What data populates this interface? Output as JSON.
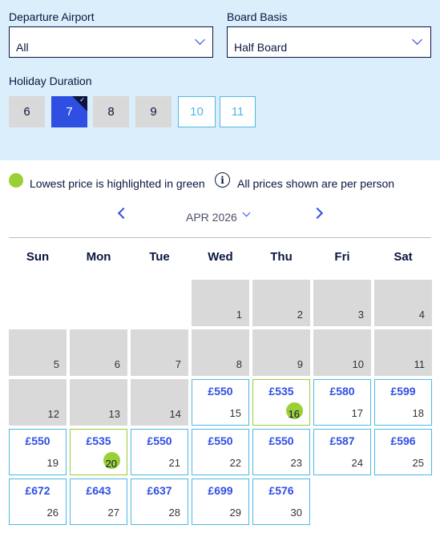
{
  "filters": {
    "departure_airport": {
      "label": "Departure Airport",
      "value": "All"
    },
    "board_basis": {
      "label": "Board Basis",
      "value": "Half Board"
    },
    "holiday_duration": {
      "label": "Holiday Duration",
      "options": [
        {
          "label": "6",
          "state": "disabled"
        },
        {
          "label": "7",
          "state": "selected"
        },
        {
          "label": "8",
          "state": "disabled"
        },
        {
          "label": "9",
          "state": "disabled"
        },
        {
          "label": "10",
          "state": "available"
        },
        {
          "label": "11",
          "state": "available"
        }
      ],
      "selected_mark": "✓"
    }
  },
  "legend": {
    "lowest_text": "Lowest price is highlighted in green",
    "info_icon": "i",
    "per_person_text": "All prices shown are per person"
  },
  "calendar": {
    "month": "APR 2026",
    "weekdays": [
      "Sun",
      "Mon",
      "Tue",
      "Wed",
      "Thu",
      "Fri",
      "Sat"
    ],
    "start_weekday_index": 3,
    "days": [
      {
        "day": "1",
        "price": "",
        "state": "past"
      },
      {
        "day": "2",
        "price": "",
        "state": "past"
      },
      {
        "day": "3",
        "price": "",
        "state": "past"
      },
      {
        "day": "4",
        "price": "",
        "state": "past"
      },
      {
        "day": "5",
        "price": "",
        "state": "past"
      },
      {
        "day": "6",
        "price": "",
        "state": "past"
      },
      {
        "day": "7",
        "price": "",
        "state": "past"
      },
      {
        "day": "8",
        "price": "",
        "state": "past"
      },
      {
        "day": "9",
        "price": "",
        "state": "past"
      },
      {
        "day": "10",
        "price": "",
        "state": "past"
      },
      {
        "day": "11",
        "price": "",
        "state": "past"
      },
      {
        "day": "12",
        "price": "",
        "state": "past"
      },
      {
        "day": "13",
        "price": "",
        "state": "past"
      },
      {
        "day": "14",
        "price": "",
        "state": "past"
      },
      {
        "day": "15",
        "price": "£550",
        "state": "available"
      },
      {
        "day": "16",
        "price": "£535",
        "state": "lowest"
      },
      {
        "day": "17",
        "price": "£580",
        "state": "available"
      },
      {
        "day": "18",
        "price": "£599",
        "state": "available"
      },
      {
        "day": "19",
        "price": "£550",
        "state": "available"
      },
      {
        "day": "20",
        "price": "£535",
        "state": "lowest"
      },
      {
        "day": "21",
        "price": "£550",
        "state": "available"
      },
      {
        "day": "22",
        "price": "£550",
        "state": "available"
      },
      {
        "day": "23",
        "price": "£550",
        "state": "available"
      },
      {
        "day": "24",
        "price": "£587",
        "state": "available"
      },
      {
        "day": "25",
        "price": "£596",
        "state": "available"
      },
      {
        "day": "26",
        "price": "£672",
        "state": "available"
      },
      {
        "day": "27",
        "price": "£643",
        "state": "available"
      },
      {
        "day": "28",
        "price": "£637",
        "state": "available"
      },
      {
        "day": "29",
        "price": "£699",
        "state": "available"
      },
      {
        "day": "30",
        "price": "£576",
        "state": "available"
      }
    ]
  },
  "colors": {
    "panel_bg": "#daeefb",
    "accent_blue": "#2f4fe3",
    "navy": "#0b1640",
    "lowest_green": "#9bcf36",
    "available_border": "#4fb9e2",
    "past_grey": "#d9d9d9"
  }
}
